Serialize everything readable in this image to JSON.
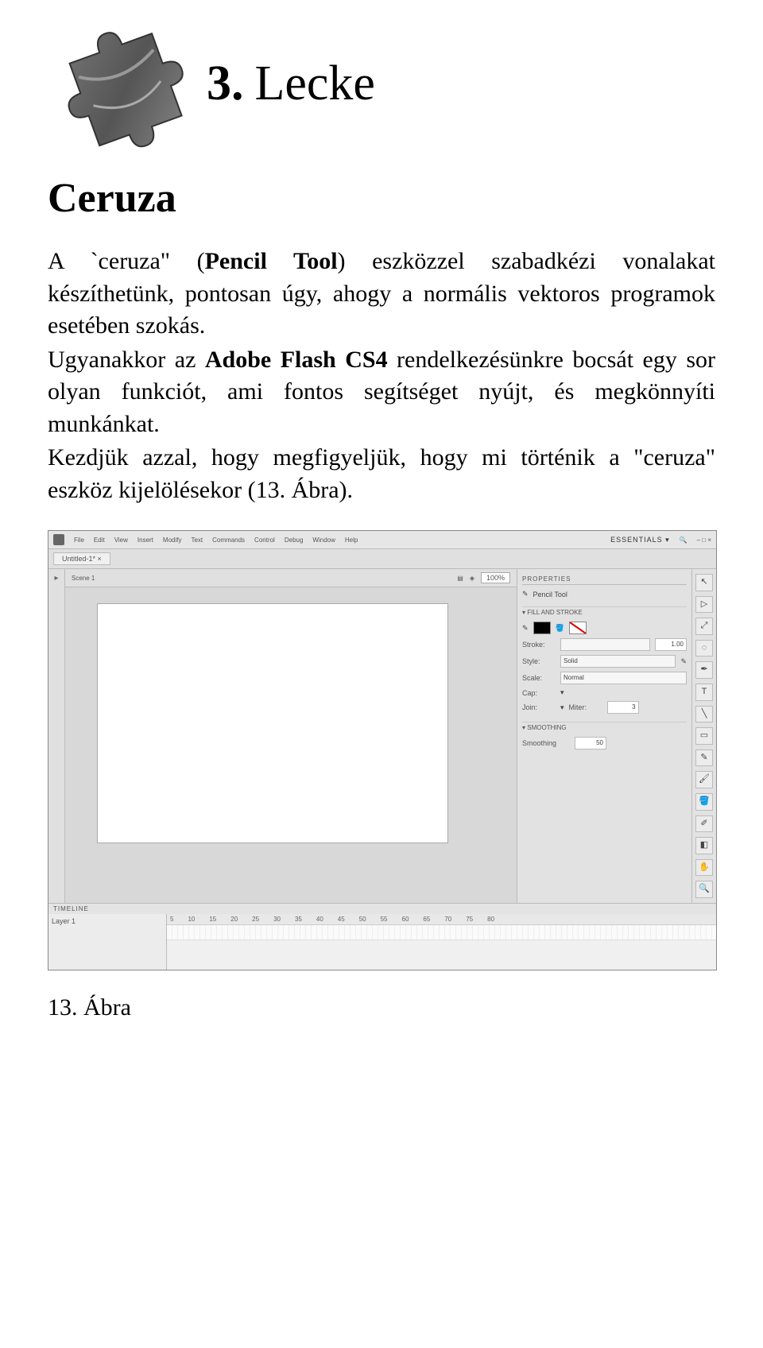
{
  "lesson": {
    "number": "3.",
    "title": "Lecke"
  },
  "section_title": "Ceruza",
  "para1_pre": "A `ceruza\" (",
  "para1_bold": "Pencil Tool",
  "para1_post": ") eszközzel szabadkézi vonalakat készíthetünk, pontosan úgy, ahogy a normális vektoros programok esetében szokás.",
  "para2_pre": "Ugyanakkor az ",
  "para2_bold": "Adobe Flash CS4",
  "para2_post": " rendelkezésünkre bocsát egy sor olyan funkciót, ami fontos segítséget nyújt, és meg­könnyíti munkánkat.",
  "para3": "Kezdjük azzal, hogy megfigyeljük, hogy mi történik a \"ceruza\" eszköz kijelölésekor (13. Ábra).",
  "figure_caption": "13. Ábra",
  "flash": {
    "menu": [
      "File",
      "Edit",
      "View",
      "Insert",
      "Modify",
      "Text",
      "Commands",
      "Control",
      "Debug",
      "Window",
      "Help"
    ],
    "workspace": "ESSENTIALS ▾",
    "doc_tab": "Untitled-1* ×",
    "scene": "Scene 1",
    "zoom": "100%",
    "properties_title": "PROPERTIES",
    "tool_name": "Pencil Tool",
    "fillstroke_title": "FILL AND STROKE",
    "stroke_label": "Stroke:",
    "stroke_value": "1.00",
    "style_label": "Style:",
    "style_value": "Solid",
    "scale_label": "Scale:",
    "scale_value": "Normal",
    "cap_label": "Cap:",
    "join_label": "Join:",
    "miter_label": "Miter:",
    "miter_value": "3",
    "smoothing_title": "SMOOTHING",
    "smoothing_label": "Smoothing",
    "smoothing_value": "50",
    "timeline_tab": "TIMELINE",
    "layer1": "Layer 1",
    "ruler": [
      "5",
      "10",
      "15",
      "20",
      "25",
      "30",
      "35",
      "40",
      "45",
      "50",
      "55",
      "60",
      "65",
      "70",
      "75",
      "80"
    ]
  }
}
